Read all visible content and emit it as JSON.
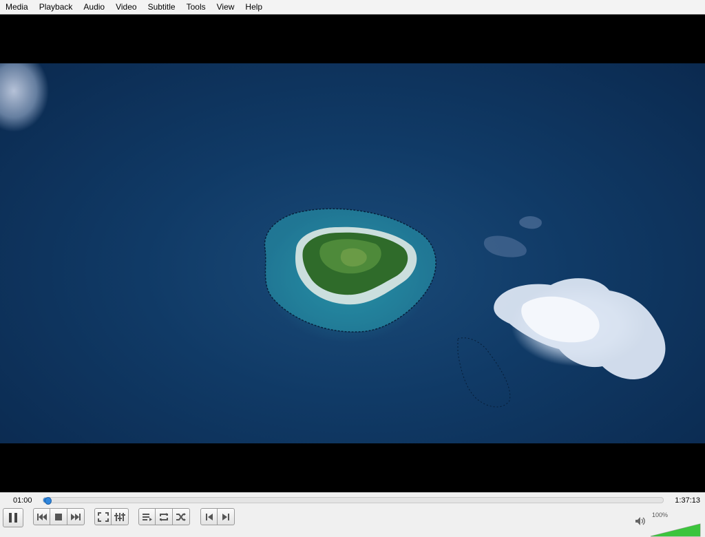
{
  "menu": [
    "Media",
    "Playback",
    "Audio",
    "Video",
    "Subtitle",
    "Tools",
    "View",
    "Help"
  ],
  "player": {
    "elapsed": "01:00",
    "total": "1:37:13",
    "progress_fraction": 0.007,
    "volume_label": "100%",
    "volume_fraction": 1.0,
    "accent_color": "#2a7fd6",
    "volume_color": "#3cc43c"
  },
  "buttons": {
    "play_pause": "pause-icon",
    "prev": "previous-icon",
    "stop": "stop-icon",
    "next": "next-icon",
    "fullscreen": "fullscreen-icon",
    "extended": "equalizer-icon",
    "playlist": "playlist-icon",
    "loop": "loop-icon",
    "random": "shuffle-icon",
    "frame_prev": "frame-back-icon",
    "frame_next": "frame-forward-icon",
    "mute": "speaker-icon"
  }
}
